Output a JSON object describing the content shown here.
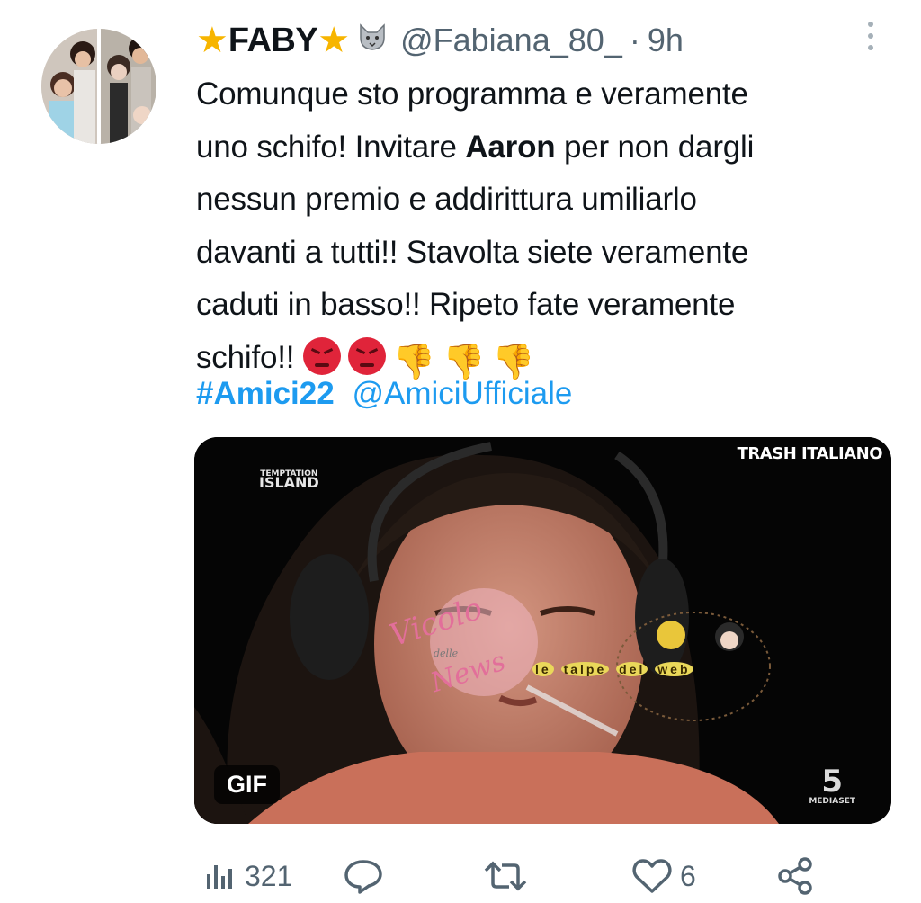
{
  "author": {
    "display_name": "FABY",
    "handle": "@Fabiana_80_",
    "separator": "·",
    "timestamp": "9h"
  },
  "tweet": {
    "lines": [
      [
        "Comunque sto programma e veramente"
      ],
      [
        "uno schifo! Invitare ",
        "Aaron",
        " per non dargli"
      ],
      [
        "nessun premio e addirittura umiliarlo"
      ],
      [
        "davanti a tutti!! Stavolta siete veramente"
      ],
      [
        "caduti in basso!! Ripeto fate veramente"
      ],
      [
        "schifo!! "
      ]
    ],
    "emojis": [
      "pouting-face",
      "pouting-face",
      "thumbs-down",
      "thumbs-down",
      "thumbs-down"
    ],
    "hashtag": "#Amici22",
    "mention": "@AmiciUfficiale"
  },
  "media": {
    "badge": "GIF",
    "watermark_top_right": "TRASH ITALIANO",
    "watermark_show_line1": "TEMPTATION",
    "watermark_show_line2": "ISLAND",
    "watermark_network_logo": "5",
    "watermark_network": "MEDIASET",
    "overlay_talpe": [
      "le",
      "talpe",
      "del",
      "web"
    ],
    "overlay_vicolo_1": "Vicolo",
    "overlay_vicolo_2": "delle",
    "overlay_vicolo_3": "News"
  },
  "actions": {
    "views_count": "321",
    "likes_count": "6",
    "icons": [
      "views-icon",
      "reply-icon",
      "retweet-icon",
      "like-icon",
      "share-icon"
    ]
  },
  "colors": {
    "link": "#1d9bf0",
    "secondary_text": "#536471",
    "star": "#f7b500"
  }
}
